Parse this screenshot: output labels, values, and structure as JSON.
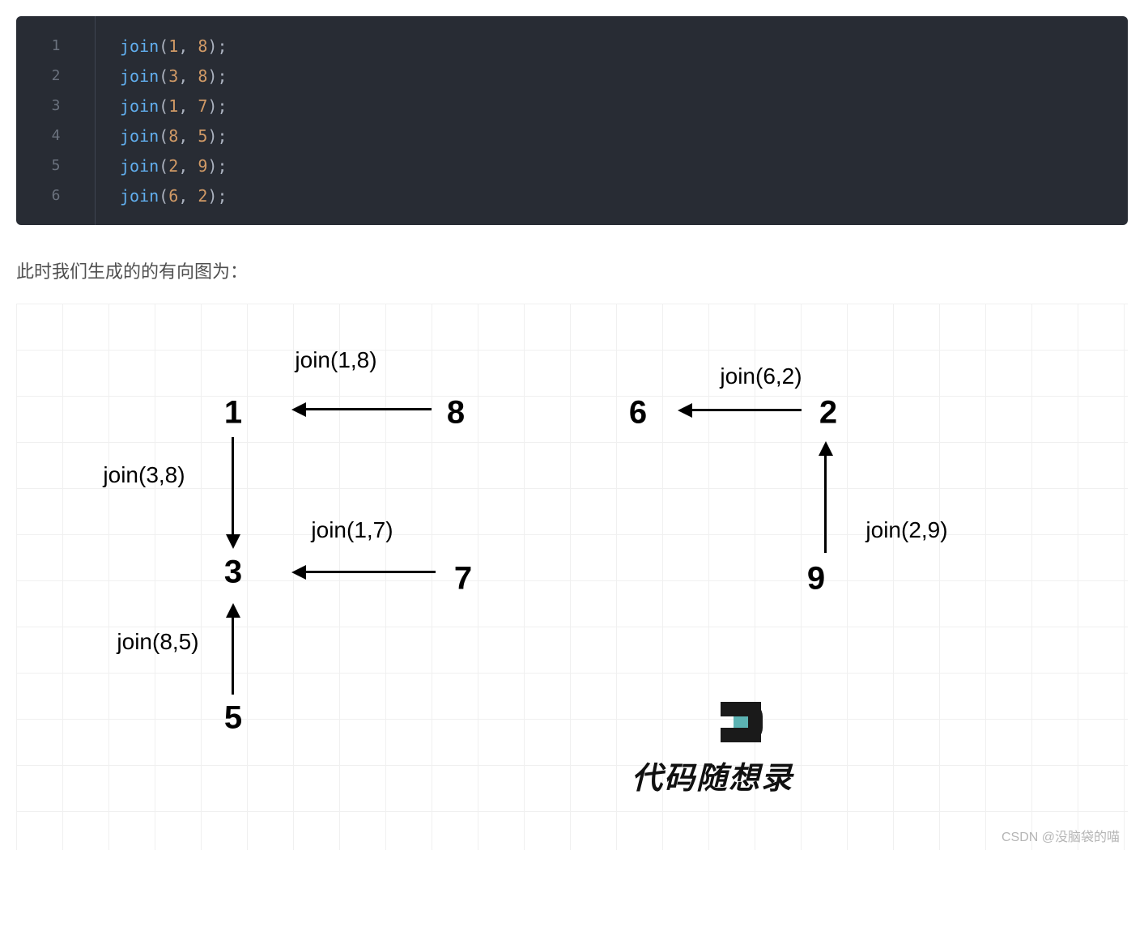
{
  "code": {
    "lines": [
      {
        "num": "1",
        "fn": "join",
        "a": "1",
        "b": "8"
      },
      {
        "num": "2",
        "fn": "join",
        "a": "3",
        "b": "8"
      },
      {
        "num": "3",
        "fn": "join",
        "a": "1",
        "b": "7"
      },
      {
        "num": "4",
        "fn": "join",
        "a": "8",
        "b": "5"
      },
      {
        "num": "5",
        "fn": "join",
        "a": "2",
        "b": "9"
      },
      {
        "num": "6",
        "fn": "join",
        "a": "6",
        "b": "2"
      }
    ]
  },
  "paragraph": "此时我们生成的的有向图为：",
  "diagram": {
    "nodes": {
      "n1": "1",
      "n8": "8",
      "n3": "3",
      "n7": "7",
      "n5": "5",
      "n6": "6",
      "n2": "2",
      "n9": "9"
    },
    "labels": {
      "l18": "join(1,8)",
      "l38": "join(3,8)",
      "l17": "join(1,7)",
      "l85": "join(8,5)",
      "l62": "join(6,2)",
      "l29": "join(2,9)"
    },
    "brand": "代码随想录",
    "watermark": "CSDN @没脑袋的喵"
  },
  "chart_data": {
    "type": "diagram",
    "description": "Union-Find join operations directed graph",
    "edges": [
      {
        "from": 8,
        "to": 1,
        "op": "join(1,8)"
      },
      {
        "from": 1,
        "to": 3,
        "op": "join(3,8)"
      },
      {
        "from": 7,
        "to": 3,
        "op": "join(1,7)"
      },
      {
        "from": 5,
        "to": 3,
        "op": "join(8,5)"
      },
      {
        "from": 2,
        "to": 6,
        "op": "join(6,2)"
      },
      {
        "from": 9,
        "to": 2,
        "op": "join(2,9)"
      }
    ],
    "nodes": [
      1,
      2,
      3,
      5,
      6,
      7,
      8,
      9
    ]
  }
}
